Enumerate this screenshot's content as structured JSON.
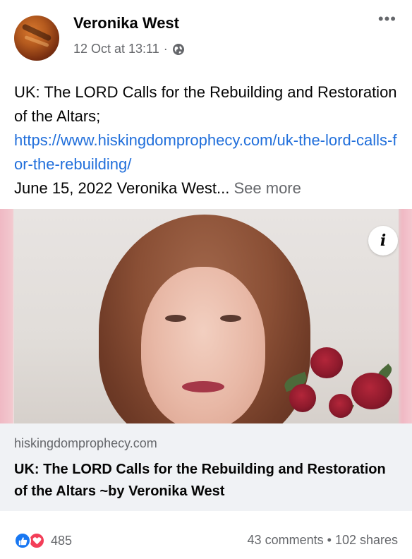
{
  "post": {
    "author": "Veronika West",
    "timestamp": "12 Oct at 13:11",
    "separator": "·",
    "privacy_icon": "globe-icon",
    "more_icon": "•••",
    "text_line1": "UK: The LORD Calls for the Rebuilding and Restoration of the Altars;",
    "link": "https://www.hiskingdomprophecy.com/uk-the-lord-calls-for-the-rebuilding/",
    "text_line2": "June 15, 2022 Veronika West...",
    "see_more": "See more"
  },
  "link_preview": {
    "info_icon": "i",
    "domain": "hiskingdomprophecy.com",
    "title": "UK: The LORD Calls for the Rebuilding and Restoration of the Altars ~by Veronika West"
  },
  "footer": {
    "reaction_count": "485",
    "comments": "43 comments",
    "dot": "•",
    "shares": "102 shares"
  },
  "colors": {
    "link": "#216fdb",
    "secondary_text": "#65676b",
    "like": "#1877f2",
    "love": "#f33e58",
    "card_bg": "#f0f2f5"
  }
}
